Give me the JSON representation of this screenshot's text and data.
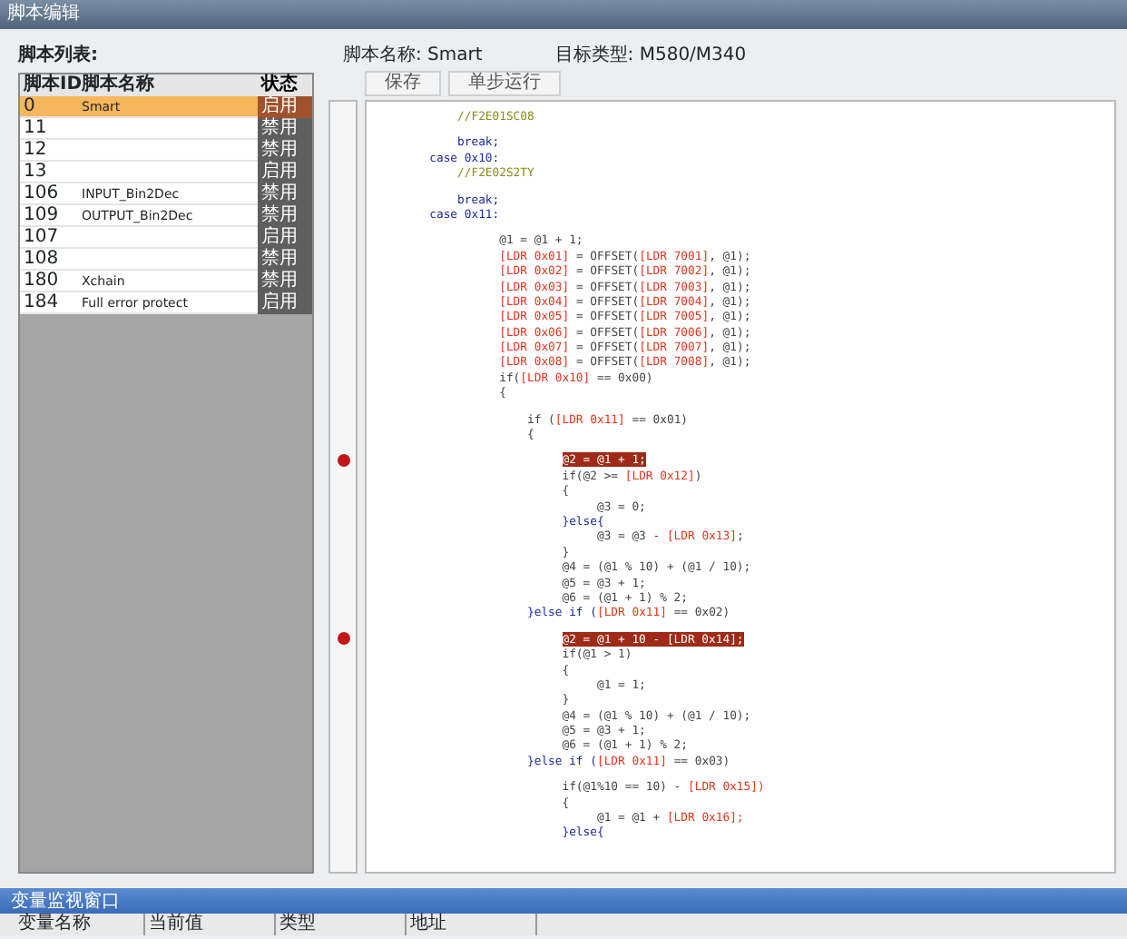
{
  "window": {
    "title": "脚本编辑"
  },
  "script_list": {
    "title": "脚本列表:",
    "columns": [
      "脚本ID",
      "脚本名称",
      "状态"
    ],
    "rows": [
      {
        "id": "0",
        "name": "Smart",
        "status": "启用",
        "selected": true
      },
      {
        "id": "11",
        "name": "",
        "status": "禁用",
        "selected": false
      },
      {
        "id": "12",
        "name": "",
        "status": "禁用",
        "selected": false
      },
      {
        "id": "13",
        "name": "",
        "status": "启用",
        "selected": false
      },
      {
        "id": "106",
        "name": "INPUT_Bin2Dec",
        "status": "禁用",
        "selected": false
      },
      {
        "id": "109",
        "name": "OUTPUT_Bin2Dec",
        "status": "禁用",
        "selected": false
      },
      {
        "id": "107",
        "name": "",
        "status": "启用",
        "selected": false
      },
      {
        "id": "108",
        "name": "",
        "status": "禁用",
        "selected": false
      },
      {
        "id": "180",
        "name": "Xchain",
        "status": "禁用",
        "selected": false
      },
      {
        "id": "184",
        "name": "Full error protect",
        "status": "启用",
        "selected": false
      }
    ]
  },
  "editor": {
    "script_name_label": "脚本名称:",
    "script_name": "Smart",
    "target_type_label": "目标类型:",
    "target_type": "M580/M340",
    "buttons": [
      "保存",
      "单步运行"
    ],
    "lines": [
      {
        "segments": [
          {
            "text": "             //F2E01SC08",
            "kind": "comment"
          }
        ]
      },
      {
        "space_before": true,
        "segments": [
          {
            "text": "             break;",
            "kind": "keyword"
          }
        ]
      },
      {
        "segments": [
          {
            "text": "         case 0x10:",
            "kind": "keyword"
          }
        ]
      },
      {
        "segments": [
          {
            "text": "             //F2E02S2TY",
            "kind": "comment"
          }
        ]
      },
      {
        "space_before": true,
        "segments": [
          {
            "text": "             break;",
            "kind": "keyword"
          }
        ]
      },
      {
        "segments": [
          {
            "text": "         case 0x11:",
            "kind": "keyword"
          }
        ]
      },
      {
        "space_before": true,
        "segments": [
          {
            "text": "                   @1 = @1 + 1;",
            "kind": "plain"
          }
        ]
      },
      {
        "segments": [
          {
            "text": "                   [LDR 0x01]",
            "kind": "expr"
          },
          {
            "text": " = OFFSET(",
            "kind": "plain"
          },
          {
            "text": "[LDR 7001]",
            "kind": "expr"
          },
          {
            "text": ", @1);",
            "kind": "plain"
          }
        ]
      },
      {
        "segments": [
          {
            "text": "                   [LDR 0x02]",
            "kind": "expr"
          },
          {
            "text": " = OFFSET(",
            "kind": "plain"
          },
          {
            "text": "[LDR 7002]",
            "kind": "expr"
          },
          {
            "text": ", @1);",
            "kind": "plain"
          }
        ]
      },
      {
        "segments": [
          {
            "text": "                   [LDR 0x03]",
            "kind": "expr"
          },
          {
            "text": " = OFFSET(",
            "kind": "plain"
          },
          {
            "text": "[LDR 7003]",
            "kind": "expr"
          },
          {
            "text": ", @1);",
            "kind": "plain"
          }
        ]
      },
      {
        "segments": [
          {
            "text": "                   [LDR 0x04]",
            "kind": "expr"
          },
          {
            "text": " = OFFSET(",
            "kind": "plain"
          },
          {
            "text": "[LDR 7004]",
            "kind": "expr"
          },
          {
            "text": ", @1);",
            "kind": "plain"
          }
        ]
      },
      {
        "segments": [
          {
            "text": "                   [LDR 0x05]",
            "kind": "expr"
          },
          {
            "text": " = OFFSET(",
            "kind": "plain"
          },
          {
            "text": "[LDR 7005]",
            "kind": "expr"
          },
          {
            "text": ", @1);",
            "kind": "plain"
          }
        ]
      },
      {
        "segments": [
          {
            "text": "                   [LDR 0x06]",
            "kind": "expr"
          },
          {
            "text": " = OFFSET(",
            "kind": "plain"
          },
          {
            "text": "[LDR 7006]",
            "kind": "expr"
          },
          {
            "text": ", @1);",
            "kind": "plain"
          }
        ]
      },
      {
        "segments": [
          {
            "text": "                   [LDR 0x07]",
            "kind": "expr"
          },
          {
            "text": " = OFFSET(",
            "kind": "plain"
          },
          {
            "text": "[LDR 7007]",
            "kind": "expr"
          },
          {
            "text": ", @1);",
            "kind": "plain"
          }
        ]
      },
      {
        "segments": [
          {
            "text": "                   [LDR 0x08]",
            "kind": "expr"
          },
          {
            "text": " = OFFSET(",
            "kind": "plain"
          },
          {
            "text": "[LDR 7008]",
            "kind": "expr"
          },
          {
            "text": ", @1);",
            "kind": "plain"
          }
        ]
      },
      {
        "segments": [
          {
            "text": "                   if(",
            "kind": "plain"
          },
          {
            "text": "[LDR 0x10]",
            "kind": "expr"
          },
          {
            "text": " == 0x00)",
            "kind": "plain"
          }
        ]
      },
      {
        "segments": [
          {
            "text": "                   {",
            "kind": "plain"
          }
        ]
      },
      {
        "space_before": true,
        "segments": [
          {
            "text": "                       if (",
            "kind": "plain"
          },
          {
            "text": "[LDR 0x11]",
            "kind": "expr"
          },
          {
            "text": " == 0x01)",
            "kind": "plain"
          }
        ]
      },
      {
        "segments": [
          {
            "text": "                       {",
            "kind": "plain"
          }
        ]
      },
      {
        "space_before": true,
        "breakpoint": true,
        "segments": [
          {
            "text": "                            @2 = @1 + 1;",
            "kind": "plain"
          }
        ]
      },
      {
        "segments": [
          {
            "text": "                            if(@2 >= ",
            "kind": "plain"
          },
          {
            "text": "[LDR 0x12]",
            "kind": "expr"
          },
          {
            "text": ")",
            "kind": "plain"
          }
        ]
      },
      {
        "segments": [
          {
            "text": "                            {",
            "kind": "plain"
          }
        ]
      },
      {
        "segments": [
          {
            "text": "                                 @3 = 0;",
            "kind": "plain"
          }
        ]
      },
      {
        "segments": [
          {
            "text": "                            }else{",
            "kind": "keyword"
          }
        ]
      },
      {
        "segments": [
          {
            "text": "                                 @3 = @3 - ",
            "kind": "plain"
          },
          {
            "text": "[LDR 0x13]",
            "kind": "expr"
          },
          {
            "text": ";",
            "kind": "plain"
          }
        ]
      },
      {
        "segments": [
          {
            "text": "                            }",
            "kind": "plain"
          }
        ]
      },
      {
        "segments": [
          {
            "text": "                            @4 = (@1 % 10) + (@1 / 10);",
            "kind": "plain"
          }
        ]
      },
      {
        "segments": [
          {
            "text": "                            @5 = @3 + 1;",
            "kind": "plain"
          }
        ]
      },
      {
        "segments": [
          {
            "text": "                            @6 = (@1 + 1) % 2;",
            "kind": "plain"
          }
        ]
      },
      {
        "segments": [
          {
            "text": "                       }else if (",
            "kind": "keyword"
          },
          {
            "text": "[LDR 0x11]",
            "kind": "expr"
          },
          {
            "text": " == 0x02)",
            "kind": "plain"
          }
        ]
      },
      {
        "space_before": true,
        "breakpoint": true,
        "segments": [
          {
            "text": "                            @2 = @1 + 10 - [LDR 0x14];",
            "kind": "plain"
          }
        ]
      },
      {
        "segments": [
          {
            "text": "                            if(@1 > 1)",
            "kind": "plain"
          }
        ]
      },
      {
        "segments": [
          {
            "text": "                            {",
            "kind": "plain"
          }
        ]
      },
      {
        "segments": [
          {
            "text": "                                 @1 = 1;",
            "kind": "plain"
          }
        ]
      },
      {
        "segments": [
          {
            "text": "                            }",
            "kind": "plain"
          }
        ]
      },
      {
        "segments": [
          {
            "text": "                            @4 = (@1 % 10) + (@1 / 10);",
            "kind": "plain"
          }
        ]
      },
      {
        "segments": [
          {
            "text": "                            @5 = @3 + 1;",
            "kind": "plain"
          }
        ]
      },
      {
        "segments": [
          {
            "text": "                            @6 = (@1 + 1) % 2;",
            "kind": "plain"
          }
        ]
      },
      {
        "segments": [
          {
            "text": "                       }else if (",
            "kind": "keyword"
          },
          {
            "text": "[LDR 0x11]",
            "kind": "expr"
          },
          {
            "text": " == 0x03)",
            "kind": "plain"
          }
        ]
      },
      {
        "space_before": true,
        "segments": [
          {
            "text": "                            if(@1%10 == 10) - ",
            "kind": "plain"
          },
          {
            "text": "[LDR 0x15])",
            "kind": "expr"
          }
        ]
      },
      {
        "segments": [
          {
            "text": "                            {",
            "kind": "plain"
          }
        ]
      },
      {
        "segments": [
          {
            "text": "                                 @1 = @1 + ",
            "kind": "plain"
          },
          {
            "text": "[LDR 0x16];",
            "kind": "expr"
          }
        ]
      },
      {
        "segments": [
          {
            "text": "                            }else{",
            "kind": "keyword"
          }
        ]
      }
    ]
  },
  "watch_panel": {
    "title": "变量监视窗口",
    "columns": [
      "变量名称",
      "当前值",
      "类型",
      "地址"
    ]
  }
}
